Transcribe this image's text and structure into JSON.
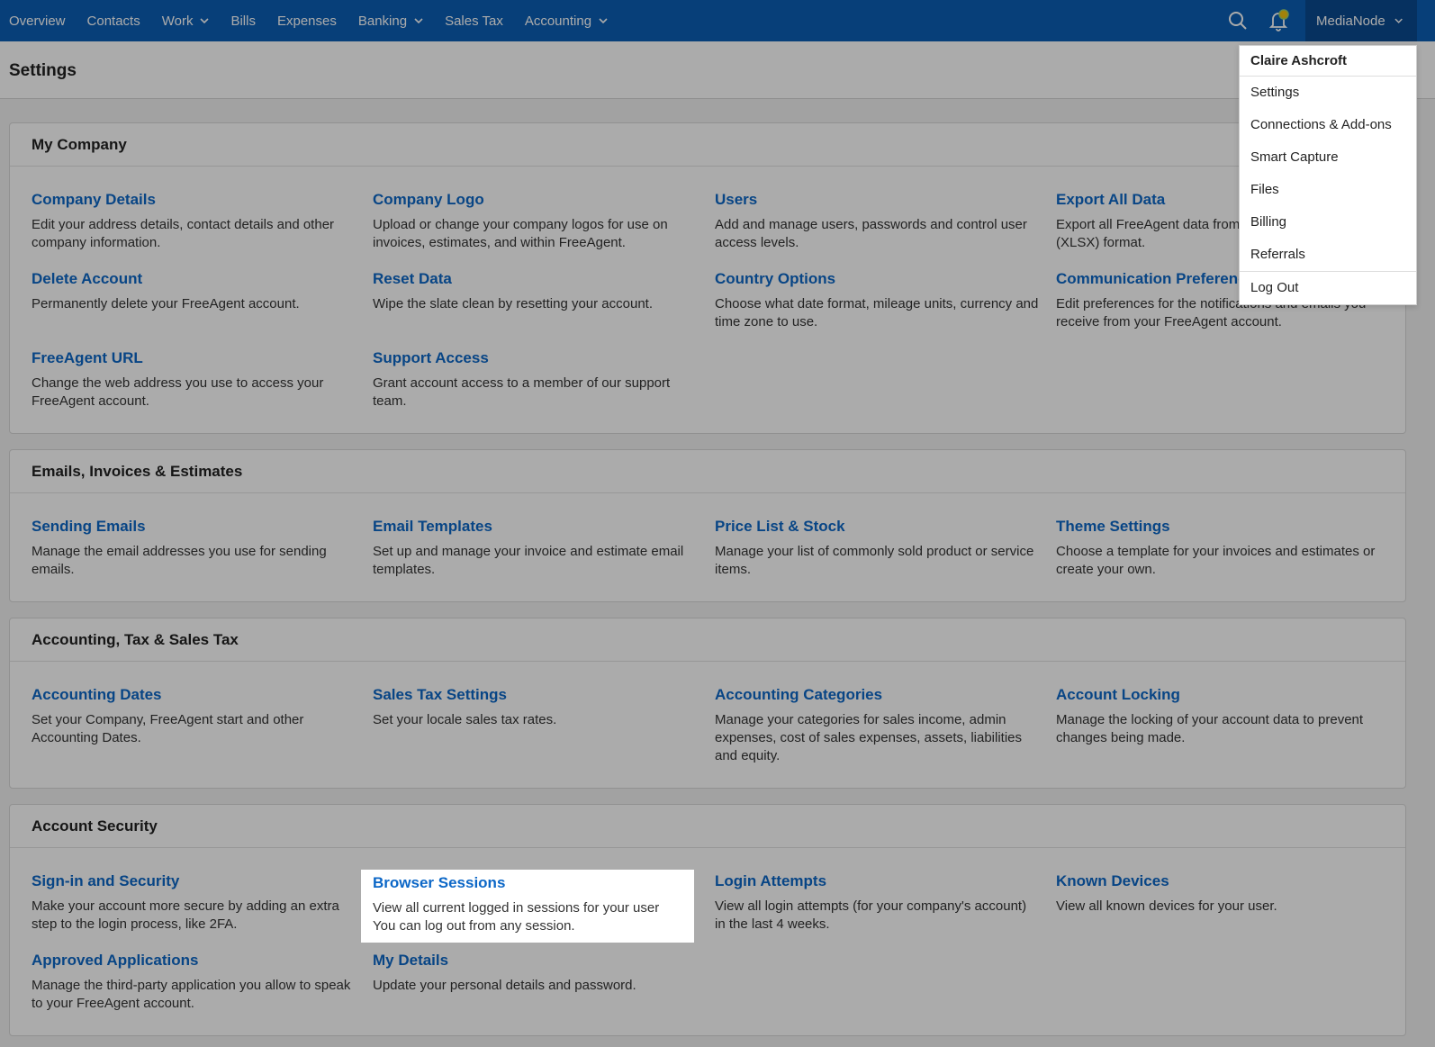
{
  "nav": {
    "items": [
      {
        "label": "Overview",
        "dropdown": false
      },
      {
        "label": "Contacts",
        "dropdown": false
      },
      {
        "label": "Work",
        "dropdown": true
      },
      {
        "label": "Bills",
        "dropdown": false
      },
      {
        "label": "Expenses",
        "dropdown": false
      },
      {
        "label": "Banking",
        "dropdown": true
      },
      {
        "label": "Sales Tax",
        "dropdown": false
      },
      {
        "label": "Accounting",
        "dropdown": true
      }
    ],
    "company": "MediaNode"
  },
  "page": {
    "title": "Settings"
  },
  "sections": [
    {
      "title": "My Company",
      "items": [
        {
          "label": "Company Details",
          "desc": "Edit your address details, contact details and other company information."
        },
        {
          "label": "Company Logo",
          "desc": "Upload or change your company logos for use on invoices, estimates, and within FreeAgent."
        },
        {
          "label": "Users",
          "desc": "Add and manage users, passwords and control user access levels."
        },
        {
          "label": "Export All Data",
          "desc": "Export all FreeAgent data from (XLSX) format."
        },
        {
          "label": "Delete Account",
          "desc": "Permanently delete your FreeAgent account."
        },
        {
          "label": "Reset Data",
          "desc": "Wipe the slate clean by resetting your account."
        },
        {
          "label": "Country Options",
          "desc": "Choose what date format, mileage units, currency and time zone to use."
        },
        {
          "label": "Communication Preferenc",
          "desc": "Edit preferences for the notifications and emails you receive from your FreeAgent account."
        },
        {
          "label": "FreeAgent URL",
          "desc": "Change the web address you use to access your FreeAgent account."
        },
        {
          "label": "Support Access",
          "desc": "Grant account access to a member of our support team."
        }
      ]
    },
    {
      "title": "Emails, Invoices & Estimates",
      "items": [
        {
          "label": "Sending Emails",
          "desc": "Manage the email addresses you use for sending emails."
        },
        {
          "label": "Email Templates",
          "desc": "Set up and manage your invoice and estimate email templates."
        },
        {
          "label": "Price List & Stock",
          "desc": "Manage your list of commonly sold product or service items."
        },
        {
          "label": "Theme Settings",
          "desc": "Choose a template for your invoices and estimates or create your own."
        }
      ]
    },
    {
      "title": "Accounting, Tax & Sales Tax",
      "items": [
        {
          "label": "Accounting Dates",
          "desc": "Set your Company, FreeAgent start and other Accounting Dates."
        },
        {
          "label": "Sales Tax Settings",
          "desc": "Set your locale sales tax rates."
        },
        {
          "label": "Accounting Categories",
          "desc": "Manage your categories for sales income, admin expenses, cost of sales expenses, assets, liabilities and equity."
        },
        {
          "label": "Account Locking",
          "desc": "Manage the locking of your account data to prevent changes being made."
        }
      ]
    },
    {
      "title": "Account Security",
      "items": [
        {
          "label": "Sign-in and Security",
          "desc": "Make your account more secure by adding an extra step to the login process, like 2FA."
        },
        {
          "label": "Browser Sessions",
          "desc": "View all current logged in sessions for your user You can log out from any session."
        },
        {
          "label": "Login Attempts",
          "desc": "View all login attempts (for your company's account) in the last 4 weeks."
        },
        {
          "label": "Known Devices",
          "desc": "View all known devices for your user."
        },
        {
          "label": "Approved Applications",
          "desc": "Manage the third-party application you allow to speak to your FreeAgent account."
        },
        {
          "label": "My Details",
          "desc": "Update your personal details and password."
        }
      ]
    }
  ],
  "dropdown": {
    "user": "Claire Ashcroft",
    "items": [
      "Settings",
      "Connections & Add-ons",
      "Smart Capture",
      "Files",
      "Billing",
      "Referrals"
    ],
    "logout": "Log Out"
  }
}
